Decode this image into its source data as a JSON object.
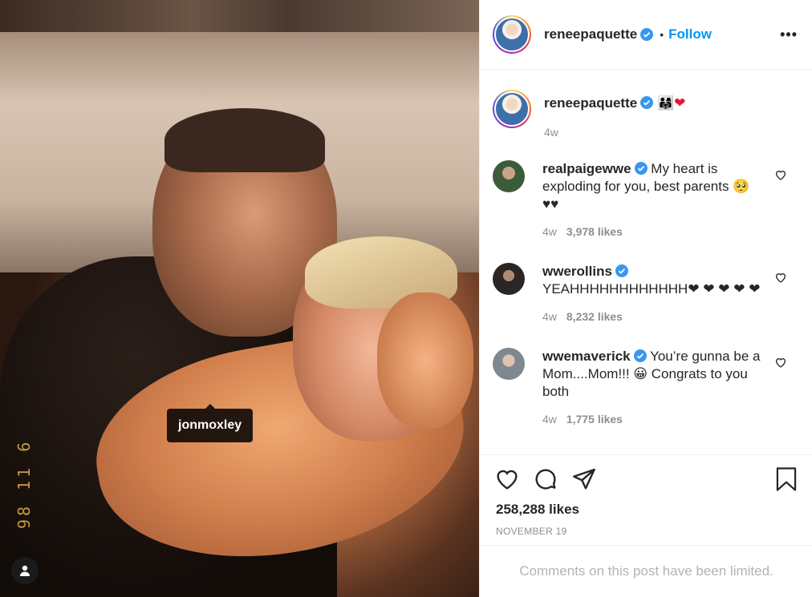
{
  "photo": {
    "date_stamp": "98 11 6",
    "tag_label": "jonmoxley"
  },
  "header": {
    "username": "reneepaquette",
    "separator": "•",
    "follow_label": "Follow",
    "more_label": "•••"
  },
  "caption": {
    "username": "reneepaquette",
    "text": "👨‍👩‍👧",
    "heart": "❤",
    "time": "4w"
  },
  "comments": [
    {
      "username": "realpaigewwe",
      "text": "My heart is exploding for you, best parents 🥺 ♥♥",
      "time": "4w",
      "likes": "3,978 likes"
    },
    {
      "username": "wwerollins",
      "text": "YEAHHHHHHHHHHHH❤ ❤ ❤ ❤ ❤",
      "time": "4w",
      "likes": "8,232 likes"
    },
    {
      "username": "wwemaverick",
      "text": "You’re gunna be a Mom....Mom!!! 😀 Congrats to you both",
      "time": "4w",
      "likes": "1,775 likes"
    }
  ],
  "post": {
    "likes": "258,288 likes",
    "date": "NOVEMBER 19",
    "comments_limited": "Comments on this post have been limited."
  },
  "colors": {
    "accent": "#0095f6",
    "verified": "#3897f0",
    "heart": "#e8153a"
  }
}
